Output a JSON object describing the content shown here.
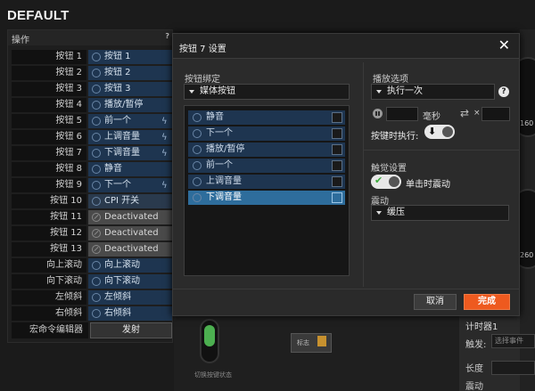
{
  "profile_title": "DEFAULT",
  "operations": {
    "title": "操作",
    "help": "?",
    "rows": [
      {
        "label": "按钮 1",
        "assignment": "按钮 1",
        "kind": "normal",
        "flash": false
      },
      {
        "label": "按钮 2",
        "assignment": "按钮 2",
        "kind": "normal",
        "flash": false
      },
      {
        "label": "按钮 3",
        "assignment": "按钮 3",
        "kind": "normal",
        "flash": false
      },
      {
        "label": "按钮 4",
        "assignment": "播放/暂停",
        "kind": "normal",
        "flash": false
      },
      {
        "label": "按钮 5",
        "assignment": "前一个",
        "kind": "normal",
        "flash": true
      },
      {
        "label": "按钮 6",
        "assignment": "上调音量",
        "kind": "normal",
        "flash": true
      },
      {
        "label": "按钮 7",
        "assignment": "下调音量",
        "kind": "normal",
        "flash": true
      },
      {
        "label": "按钮 8",
        "assignment": "静音",
        "kind": "normal",
        "flash": false
      },
      {
        "label": "按钮 9",
        "assignment": "下一个",
        "kind": "normal",
        "flash": true
      },
      {
        "label": "按钮 10",
        "assignment": "CPI 开关",
        "kind": "cpi",
        "flash": false
      },
      {
        "label": "按钮 11",
        "assignment": "Deactivated",
        "kind": "deact",
        "flash": false
      },
      {
        "label": "按钮 12",
        "assignment": "Deactivated",
        "kind": "deact",
        "flash": false
      },
      {
        "label": "按钮 13",
        "assignment": "Deactivated",
        "kind": "deact",
        "flash": false
      },
      {
        "label": "向上滚动",
        "assignment": "向上滚动",
        "kind": "normal",
        "flash": false
      },
      {
        "label": "向下滚动",
        "assignment": "向下滚动",
        "kind": "normal",
        "flash": false
      },
      {
        "label": "左倾斜",
        "assignment": "左倾斜",
        "kind": "normal",
        "flash": false
      },
      {
        "label": "右倾斜",
        "assignment": "右倾斜",
        "kind": "normal",
        "flash": false
      }
    ],
    "macro_editor_label": "宏命令编辑器",
    "launch_label": "发射"
  },
  "dialog": {
    "title": "按钮 7 设置",
    "close": "✕",
    "binding_label": "按钮绑定",
    "binding_value": "媒体按钮",
    "actions": [
      {
        "label": "静音",
        "selected": false
      },
      {
        "label": "下一个",
        "selected": false
      },
      {
        "label": "播放/暂停",
        "selected": false
      },
      {
        "label": "前一个",
        "selected": false
      },
      {
        "label": "上调音量",
        "selected": false
      },
      {
        "label": "下调音量",
        "selected": true
      }
    ],
    "playback_label": "播放选项",
    "execute_value": "执行一次",
    "help": "?",
    "ms_label": "毫秒",
    "times_label": "×",
    "press_execute_label": "按键时执行:",
    "haptic_label": "触觉设置",
    "single_click_label": "单击时震动",
    "vibrate_label": "震动",
    "vibrate_value": "缓压",
    "cancel_label": "取消",
    "done_label": "完成"
  },
  "bottom": {
    "switch_caption": "切换按键状态",
    "tag_label": "标志",
    "timer_title": "计时器1",
    "trigger_label": "触发:",
    "trigger_placeholder": "选择事件",
    "duration_label": "长度",
    "vibrate_label": "震动"
  },
  "right_strip": {
    "tick_top": "160",
    "tick_bottom": "260"
  },
  "colors": {
    "accent": "#ee5a1f",
    "assignment_blue": "#1e3550",
    "selected_blue": "#2e6d9c"
  }
}
